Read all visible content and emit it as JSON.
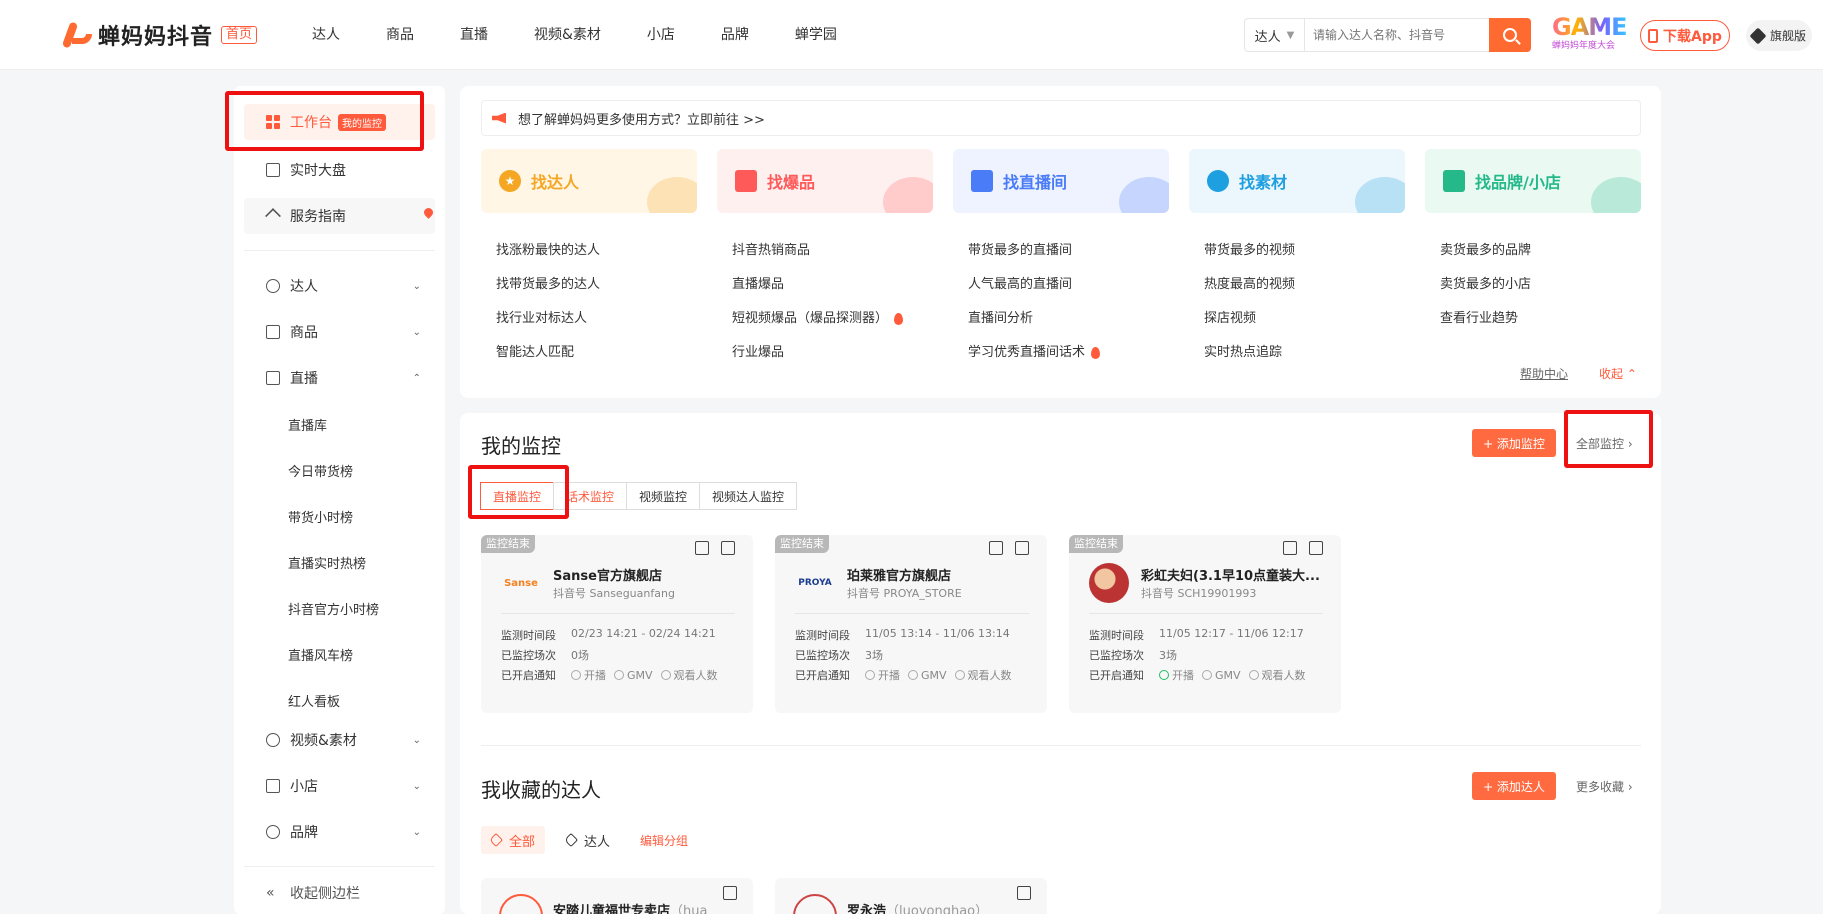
{
  "header": {
    "brand": "蝉妈妈抖音",
    "home_badge": "首页",
    "nav": [
      "达人",
      "商品",
      "直播",
      "视频&素材",
      "小店",
      "品牌",
      "蝉学园"
    ],
    "search_type": "达人",
    "search_placeholder": "请输入达人名称、抖音号",
    "event_logo_big": "GAME",
    "event_logo_small": "蝉妈妈年度大会",
    "download_app": "下载App",
    "vip_label": "旗舰版"
  },
  "sidebar": {
    "workbench": "工作台",
    "workbench_badge": "我的监控",
    "realtime": "实时大盘",
    "guide": "服务指南",
    "sections": [
      "达人",
      "商品",
      "直播"
    ],
    "live_sub": [
      "直播库",
      "今日带货榜",
      "带货小时榜",
      "直播实时热榜",
      "抖音官方小时榜",
      "直播风车榜",
      "红人看板"
    ],
    "more_sections": [
      "视频&素材",
      "小店",
      "品牌"
    ],
    "collapse": "收起侧边栏"
  },
  "notice": "想了解蝉妈妈更多使用方式？立即前往 >>",
  "categories": [
    {
      "title": "找达人",
      "color": "#f5a623",
      "bg": "#fff6e6",
      "links": [
        "找涨粉最快的达人",
        "找带货最多的达人",
        "找行业对标达人",
        "智能达人匹配"
      ]
    },
    {
      "title": "找爆品",
      "color": "#ff5a5a",
      "bg": "#fff0f0",
      "links": [
        "抖音热销商品",
        "直播爆品",
        "短视频爆品（爆品探测器）",
        "行业爆品"
      ]
    },
    {
      "title": "找直播间",
      "color": "#4a7cf7",
      "bg": "#eef3ff",
      "links": [
        "带货最多的直播间",
        "人气最高的直播间",
        "直播间分析",
        "学习优秀直播间话术"
      ]
    },
    {
      "title": "找素材",
      "color": "#1e9fe0",
      "bg": "#ebf7fd",
      "links": [
        "带货最多的视频",
        "热度最高的视频",
        "探店视频",
        "实时热点追踪"
      ]
    },
    {
      "title": "找品牌/小店",
      "color": "#25b98a",
      "bg": "#eafaf3",
      "links": [
        "卖货最多的品牌",
        "卖货最多的小店",
        "查看行业趋势"
      ]
    }
  ],
  "help_center": "帮助中心",
  "collapse_label": "收起",
  "monitor": {
    "title": "我的监控",
    "add_button": "+ 添加监控",
    "all_link": "全部监控",
    "tabs": [
      "直播监控",
      "话术监控",
      "视频监控",
      "视频达人监控"
    ],
    "cards": [
      {
        "status": "监控结束",
        "name": "Sanse官方旗舰店",
        "account": "抖音号 Sanseguanfang",
        "period_label": "监测时间段",
        "period": "02/23 14:21 - 02/24 14:21",
        "count_label": "已监控场次",
        "count": "0场",
        "notify_label": "已开启通知",
        "notify": [
          "开播",
          "GMV",
          "观看人数"
        ],
        "avatar_text": "Sanse",
        "avatar_color": "#f58220"
      },
      {
        "status": "监控结束",
        "name": "珀莱雅官方旗舰店",
        "account": "抖音号 PROYA_STORE",
        "period_label": "监测时间段",
        "period": "11/05 13:14 - 11/06 13:14",
        "count_label": "已监控场次",
        "count": "3场",
        "notify_label": "已开启通知",
        "notify": [
          "开播",
          "GMV",
          "观看人数"
        ],
        "avatar_text": "PROYA",
        "avatar_color": "#1a3d8f"
      },
      {
        "status": "监控结束",
        "name": "彩虹夫妇(3.1早10点童装大...",
        "account": "抖音号 SCH19901993",
        "period_label": "监测时间段",
        "period": "11/05 12:17 - 11/06 12:17",
        "count_label": "已监控场次",
        "count": "3场",
        "notify_label": "已开启通知",
        "notify": [
          "开播",
          "GMV",
          "观看人数"
        ],
        "avatar_text": "",
        "avatar_color": "#c44"
      }
    ]
  },
  "favorites": {
    "title": "我收藏的达人",
    "add_button": "+ 添加达人",
    "more_link": "更多收藏",
    "tags": [
      "全部",
      "达人"
    ],
    "edit_group": "编辑分组",
    "cards": [
      {
        "name": "安踏儿童福世专卖店",
        "sub": "（hua"
      },
      {
        "name": "罗永浩",
        "sub": "（luoyonghao）"
      }
    ]
  }
}
